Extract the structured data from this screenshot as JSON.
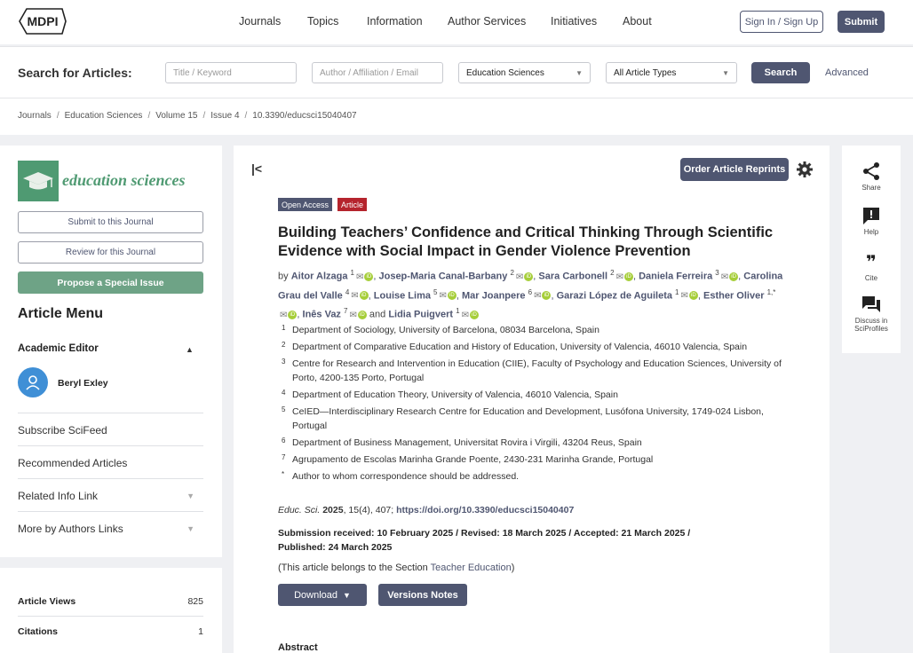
{
  "header": {
    "logo": "MDPI",
    "nav": [
      "Journals",
      "Topics",
      "Information",
      "Author Services",
      "Initiatives",
      "About"
    ],
    "signin": "Sign In / Sign Up",
    "submit": "Submit"
  },
  "search": {
    "label": "Search for Articles:",
    "title_placeholder": "Title / Keyword",
    "author_placeholder": "Author / Affiliation / Email",
    "journal_selected": "Education Sciences",
    "type_selected": "All Article Types",
    "search_button": "Search",
    "advanced": "Advanced"
  },
  "breadcrumb": [
    "Journals",
    "Education Sciences",
    "Volume 15",
    "Issue 4",
    "10.3390/educsci15040407"
  ],
  "sidebar": {
    "journal_name": "education sciences",
    "submit_btn": "Submit to this Journal",
    "review_btn": "Review for this Journal",
    "propose_btn": "Propose a Special Issue",
    "menu_title": "Article Menu",
    "academic_editor": "Academic Editor",
    "editor_name": "Beryl Exley",
    "items": [
      {
        "label": "Subscribe SciFeed",
        "has_chevron": false
      },
      {
        "label": "Recommended Articles",
        "has_chevron": false
      },
      {
        "label": "Related Info Link",
        "has_chevron": true
      },
      {
        "label": "More by Authors Links",
        "has_chevron": true
      }
    ],
    "stats": [
      {
        "label": "Article Views",
        "value": "825"
      },
      {
        "label": "Citations",
        "value": "1"
      }
    ]
  },
  "article": {
    "reprints_btn": "Order Article Reprints",
    "badge_oa": "Open Access",
    "badge_type": "Article",
    "title": "Building Teachers’ Confidence and Critical Thinking Through Scientific Evidence with Social Impact in Gender Violence Prevention",
    "by": "by",
    "authors": [
      {
        "name": "Aitor Alzaga",
        "sup": "1"
      },
      {
        "name": "Josep-Maria Canal-Barbany",
        "sup": "2"
      },
      {
        "name": "Sara Carbonell",
        "sup": "2"
      },
      {
        "name": "Daniela Ferreira",
        "sup": "3"
      },
      {
        "name": "Carolina Grau del Valle",
        "sup": "4"
      },
      {
        "name": "Louise Lima",
        "sup": "5"
      },
      {
        "name": "Mar Joanpere",
        "sup": "6"
      },
      {
        "name": "Garazi López de Aguileta",
        "sup": "1"
      },
      {
        "name": "Esther Oliver",
        "sup": "1,*"
      },
      {
        "name": "Inês Vaz",
        "sup": "7"
      },
      {
        "name": "Lidia Puigvert",
        "sup": "1"
      }
    ],
    "and": "and",
    "affiliations": [
      {
        "n": "1",
        "text": "Department of Sociology, University of Barcelona, 08034 Barcelona, Spain"
      },
      {
        "n": "2",
        "text": "Department of Comparative Education and History of Education, University of Valencia, 46010 Valencia, Spain"
      },
      {
        "n": "3",
        "text": "Centre for Research and Intervention in Education (CIIE), Faculty of Psychology and Education Sciences, University of Porto, 4200-135 Porto, Portugal"
      },
      {
        "n": "4",
        "text": "Department of Education Theory, University of Valencia, 46010 Valencia, Spain"
      },
      {
        "n": "5",
        "text": "CeIED—Interdisciplinary Research Centre for Education and Development, Lusófona University, 1749-024 Lisbon, Portugal"
      },
      {
        "n": "6",
        "text": "Department of Business Management, Universitat Rovira i Virgili, 43204 Reus, Spain"
      },
      {
        "n": "7",
        "text": "Agrupamento de Escolas Marinha Grande Poente, 2430-231 Marinha Grande, Portugal"
      },
      {
        "n": "*",
        "text": "Author to whom correspondence should be addressed."
      }
    ],
    "cite_journal": "Educ. Sci.",
    "cite_year": "2025",
    "cite_rest": ", 15(4), 407; ",
    "cite_doi": "https://doi.org/10.3390/educsci15040407",
    "dates": "Submission received: 10 February 2025 / Revised: 18 March 2025 / Accepted: 21 March 2025 / Published: 24 March 2025",
    "section_prefix": "(This article belongs to the Section ",
    "section_name": "Teacher Education",
    "section_suffix": ")",
    "download_btn": "Download",
    "versions_btn": "Versions Notes",
    "abstract_heading": "Abstract"
  },
  "tools": [
    {
      "label": "Share",
      "icon": "share-icon"
    },
    {
      "label": "Help",
      "icon": "help-icon"
    },
    {
      "label": "Cite",
      "icon": "quote-icon"
    },
    {
      "label": "Discuss in SciProfiles",
      "icon": "chat-icon"
    }
  ],
  "colors": {
    "primary": "#4f5671",
    "journal_green": "#4f9a72",
    "article_badge": "#b5242d",
    "orcid": "#a6ce39"
  }
}
